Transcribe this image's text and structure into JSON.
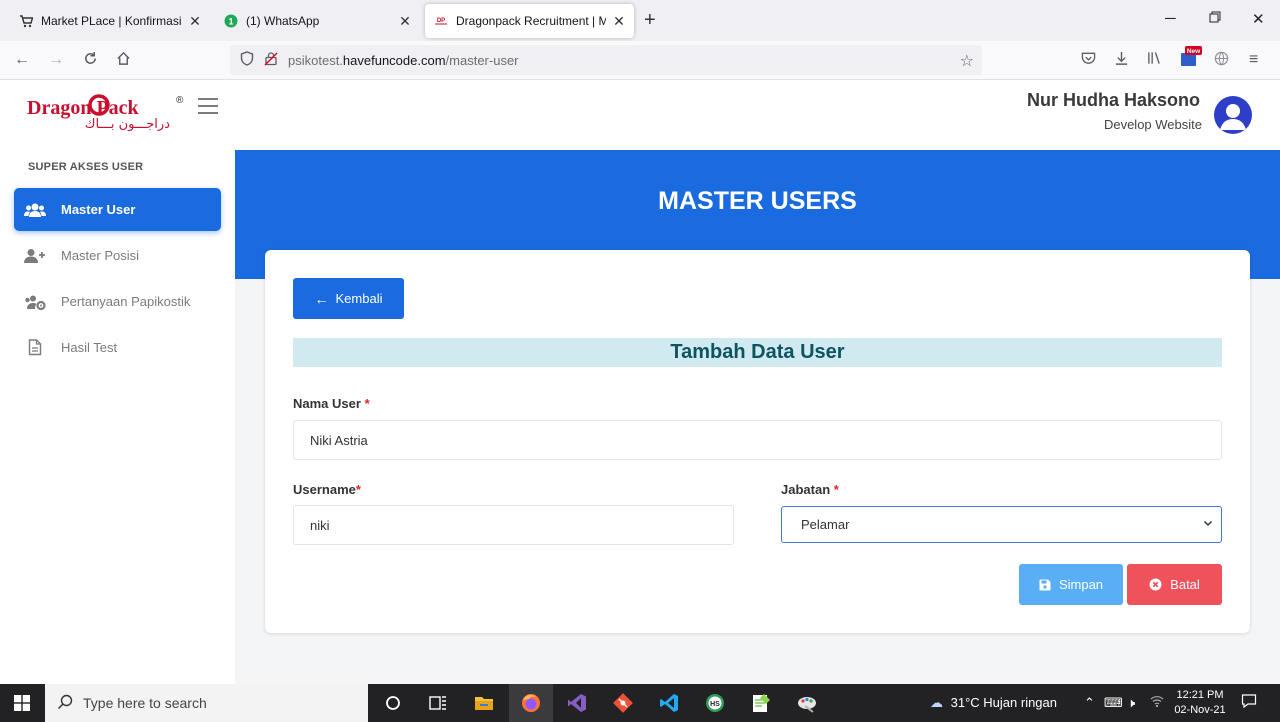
{
  "browser": {
    "tabs": [
      {
        "title": "Market PLace | Konfirmasi Pem",
        "active": false
      },
      {
        "title": "(1) WhatsApp",
        "active": false
      },
      {
        "title": "Dragonpack Recruitment | Mast",
        "active": true
      }
    ],
    "url_prefix": "psikotest.",
    "url_host": "havefuncode.com",
    "url_path": "/master-user",
    "badge_new": "New"
  },
  "header": {
    "logo_text": "Dragon Pack",
    "logo_arabic": "دراجـــون بـــاك",
    "user_name": "Nur Hudha Haksono",
    "user_role": "Develop Website"
  },
  "sidebar": {
    "section_title": "SUPER AKSES USER",
    "items": [
      {
        "label": "Master User",
        "icon": "users-icon",
        "active": true
      },
      {
        "label": "Master Posisi",
        "icon": "user-plus-icon",
        "active": false
      },
      {
        "label": "Pertanyaan Papikostik",
        "icon": "users-cog-icon",
        "active": false
      },
      {
        "label": "Hasil Test",
        "icon": "file-icon",
        "active": false
      }
    ]
  },
  "page": {
    "banner_title": "MASTER USERS",
    "back_label": "Kembali",
    "form_title": "Tambah Data User",
    "fields": {
      "nama_label": "Nama User",
      "nama_value": "Niki Astria",
      "username_label": "Username",
      "username_value": "niki",
      "jabatan_label": "Jabatan",
      "jabatan_value": "Pelamar",
      "required_mark": "*"
    },
    "save_label": "Simpan",
    "cancel_label": "Batal"
  },
  "taskbar": {
    "search_placeholder": "Type here to search",
    "weather": "31°C  Hujan ringan",
    "time": "12:21 PM",
    "date": "02-Nov-21"
  },
  "colors": {
    "primary": "#1a6be0",
    "save": "#5aaef5",
    "cancel": "#f0525c",
    "form_title_bg": "#d1e9f0"
  }
}
